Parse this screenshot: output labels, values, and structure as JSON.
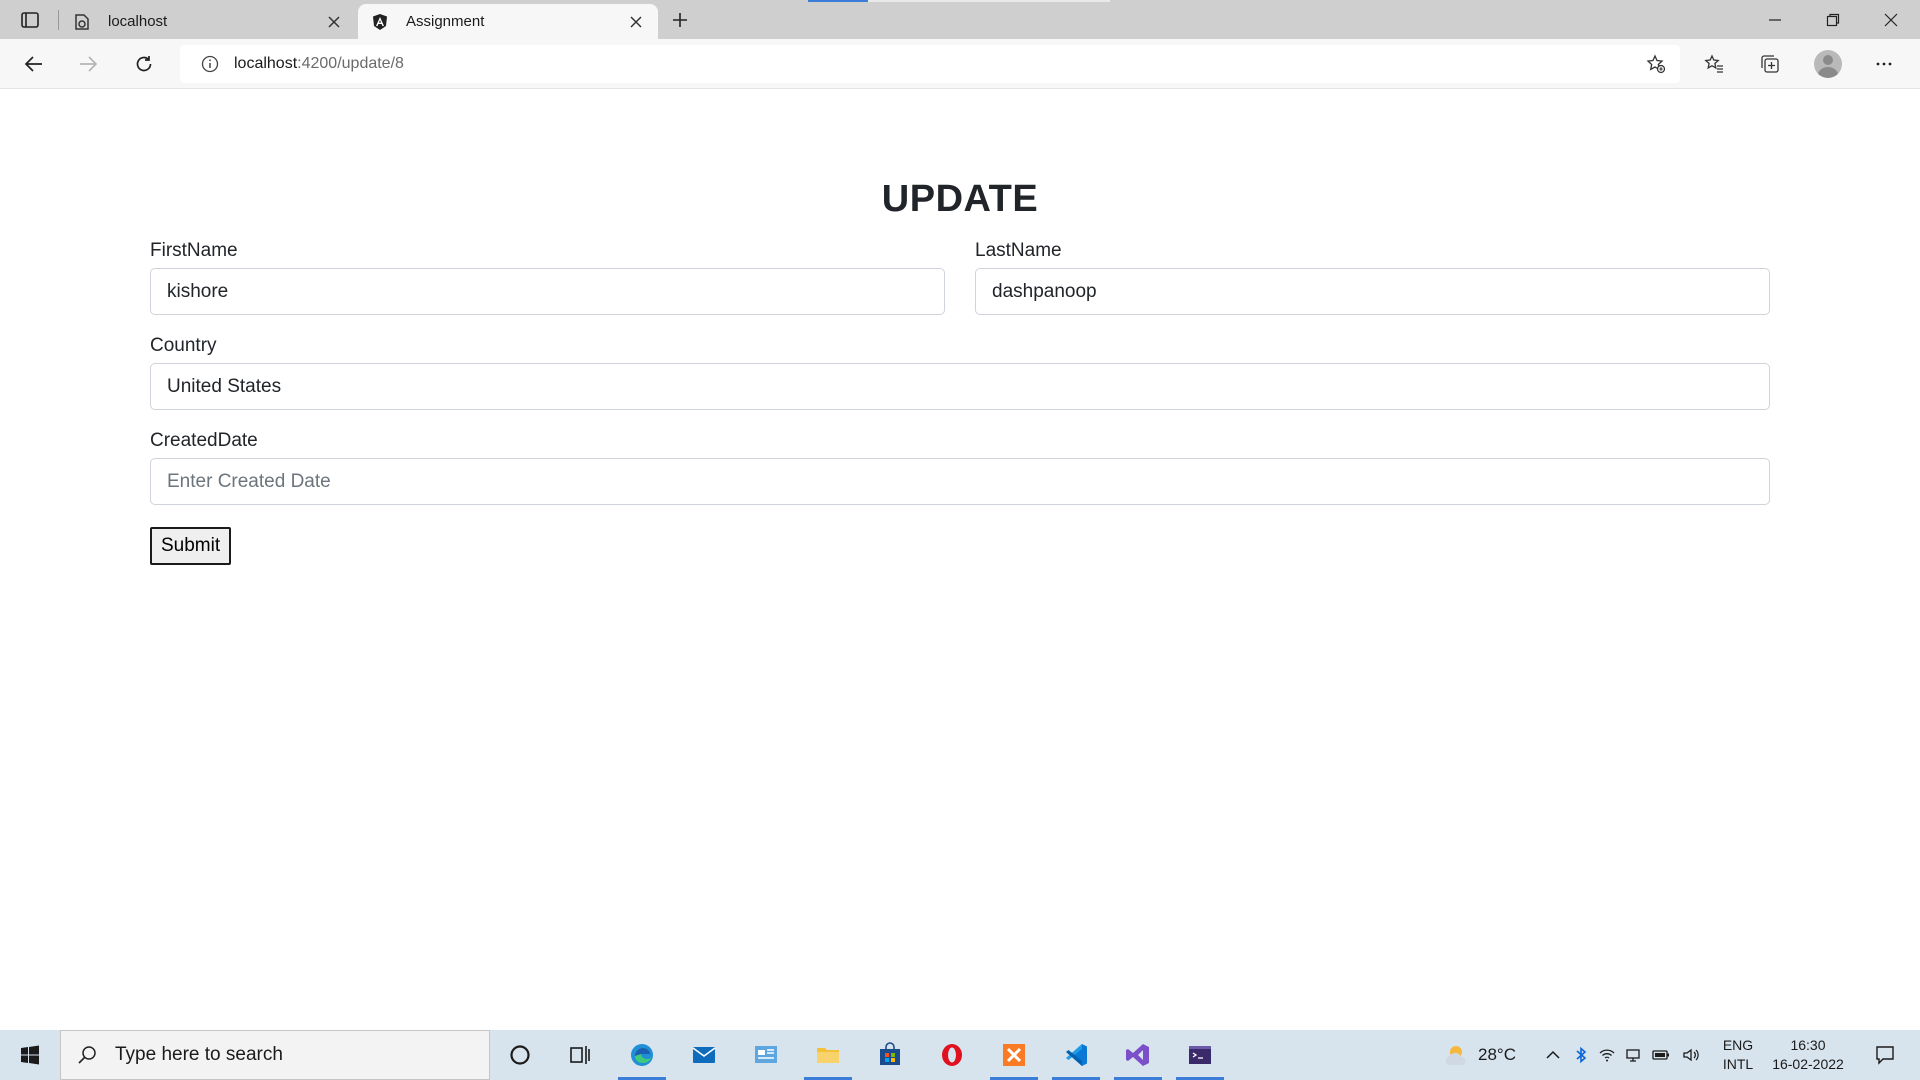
{
  "browser": {
    "tabs": [
      {
        "title": "localhost",
        "favicon": "page-icon",
        "active": false
      },
      {
        "title": "Assignment",
        "favicon": "angular-icon",
        "active": true
      }
    ],
    "address": {
      "host": "localhost",
      "path": ":4200/update/8"
    }
  },
  "form": {
    "title": "UPDATE",
    "first_name": {
      "label": "FirstName",
      "value": "kishore"
    },
    "last_name": {
      "label": "LastName",
      "value": "dashpanoop"
    },
    "country": {
      "label": "Country",
      "value": "United States"
    },
    "created_date": {
      "label": "CreatedDate",
      "value": "",
      "placeholder": "Enter Created Date"
    },
    "submit_label": "Submit"
  },
  "taskbar": {
    "search_placeholder": "Type here to search",
    "weather_temp": "28°C",
    "language": [
      "ENG",
      "INTL"
    ],
    "time": "16:30",
    "date": "16-02-2022"
  },
  "colors": {
    "accent": "#3b7dd8",
    "taskbar_bg": "#d7e3ed",
    "tabbar_bg": "#cfcfcf"
  }
}
